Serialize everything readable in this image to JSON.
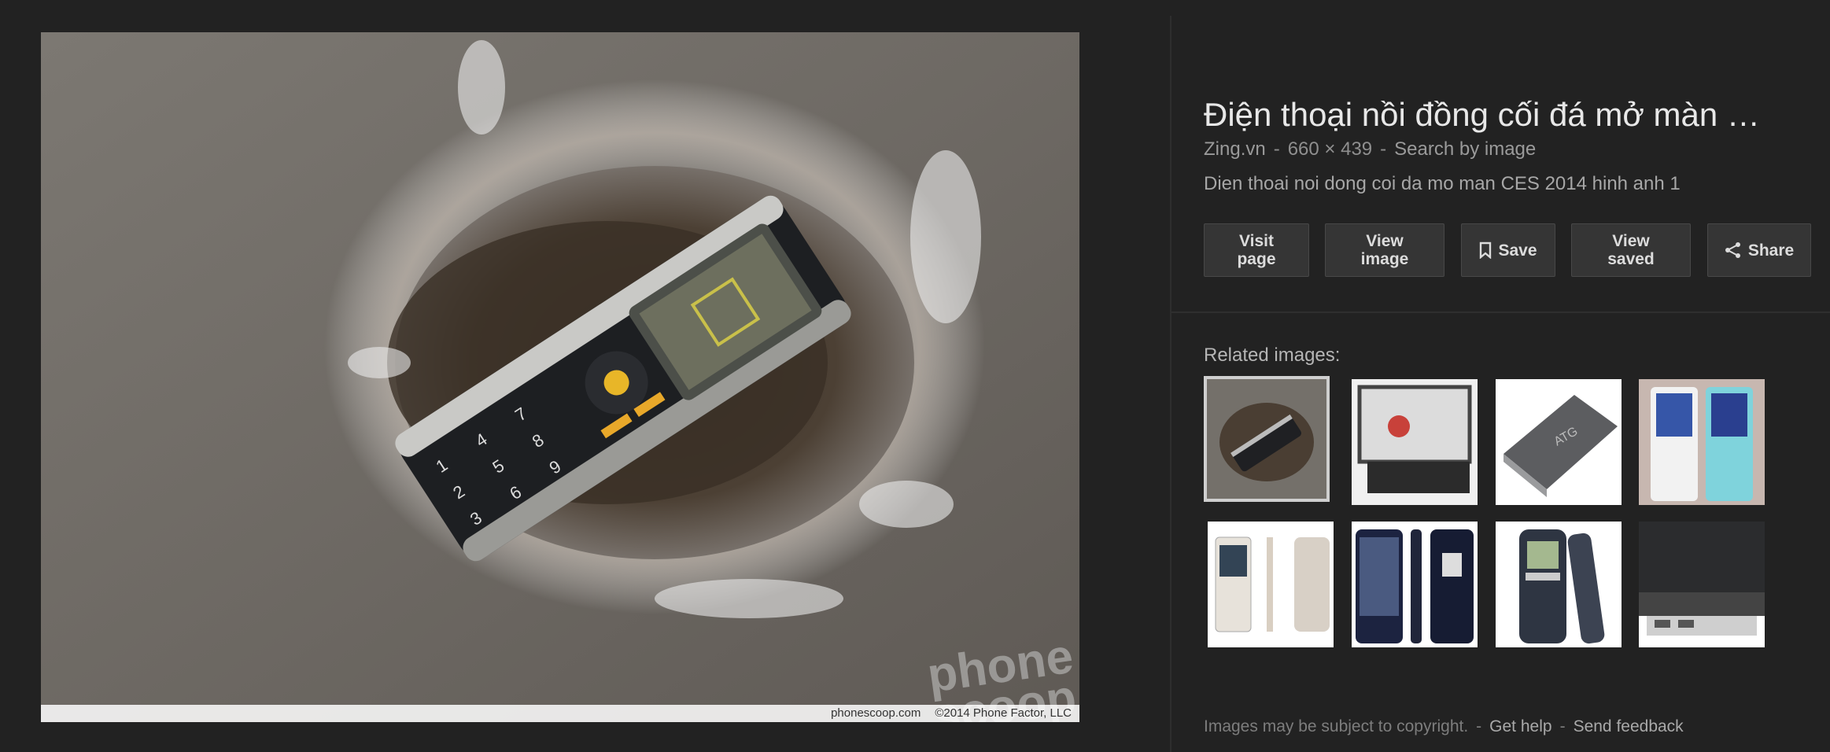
{
  "image": {
    "watermark_top": "phone",
    "watermark_bottom": "scoop",
    "footer_site": "phonescoop.com",
    "footer_copyright": "©2014 Phone Factor, LLC"
  },
  "panel": {
    "title": "Điện thoại nồi đồng cối đá mở màn …",
    "source": "Zing.vn",
    "dimensions": "660 × 439",
    "search_by_image": "Search by image",
    "meta_separator": "-",
    "description": "Dien thoai noi dong coi da mo man CES 2014 hinh anh 1"
  },
  "buttons": {
    "visit_page": "Visit page",
    "view_image": "View image",
    "save": "Save",
    "view_saved": "View saved",
    "share": "Share"
  },
  "related": {
    "label": "Related images:"
  },
  "footer": {
    "notice": "Images may be subject to copyright.",
    "separator": "-",
    "get_help": "Get help",
    "send_feedback": "Send feedback"
  },
  "icons": {
    "save": "bookmark-icon",
    "share": "share-icon"
  },
  "colors": {
    "background": "#222222",
    "button_bg": "#353535",
    "title_text": "#e8e8e8"
  }
}
